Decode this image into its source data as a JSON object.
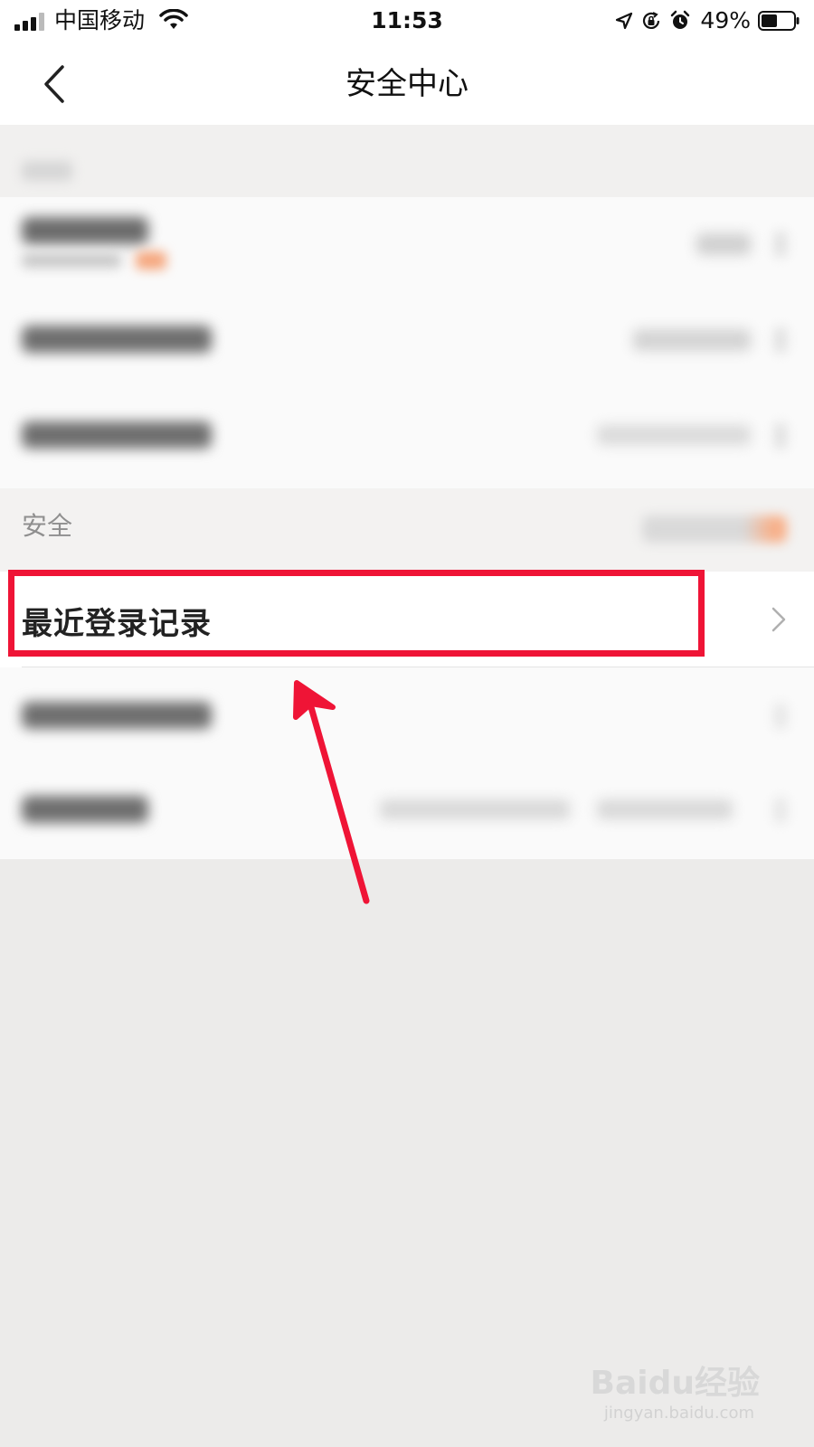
{
  "status_bar": {
    "carrier": "中国移动",
    "time": "11:53",
    "battery": "49%",
    "icons": [
      "signal-icon",
      "wifi-icon",
      "location-icon",
      "rotation-lock-icon",
      "alarm-icon",
      "battery-icon"
    ]
  },
  "nav": {
    "title": "安全中心",
    "back_icon": "chevron-left-icon"
  },
  "section_security": {
    "label": "安全"
  },
  "login_row": {
    "label": "最近登录记录",
    "icon": "chevron-right-icon"
  },
  "colors": {
    "highlight": "#ef1436",
    "background": "#ecebea",
    "row_background": "#ffffff"
  },
  "watermark": {
    "brand": "Baidu经验",
    "url": "jingyan.baidu.com"
  }
}
